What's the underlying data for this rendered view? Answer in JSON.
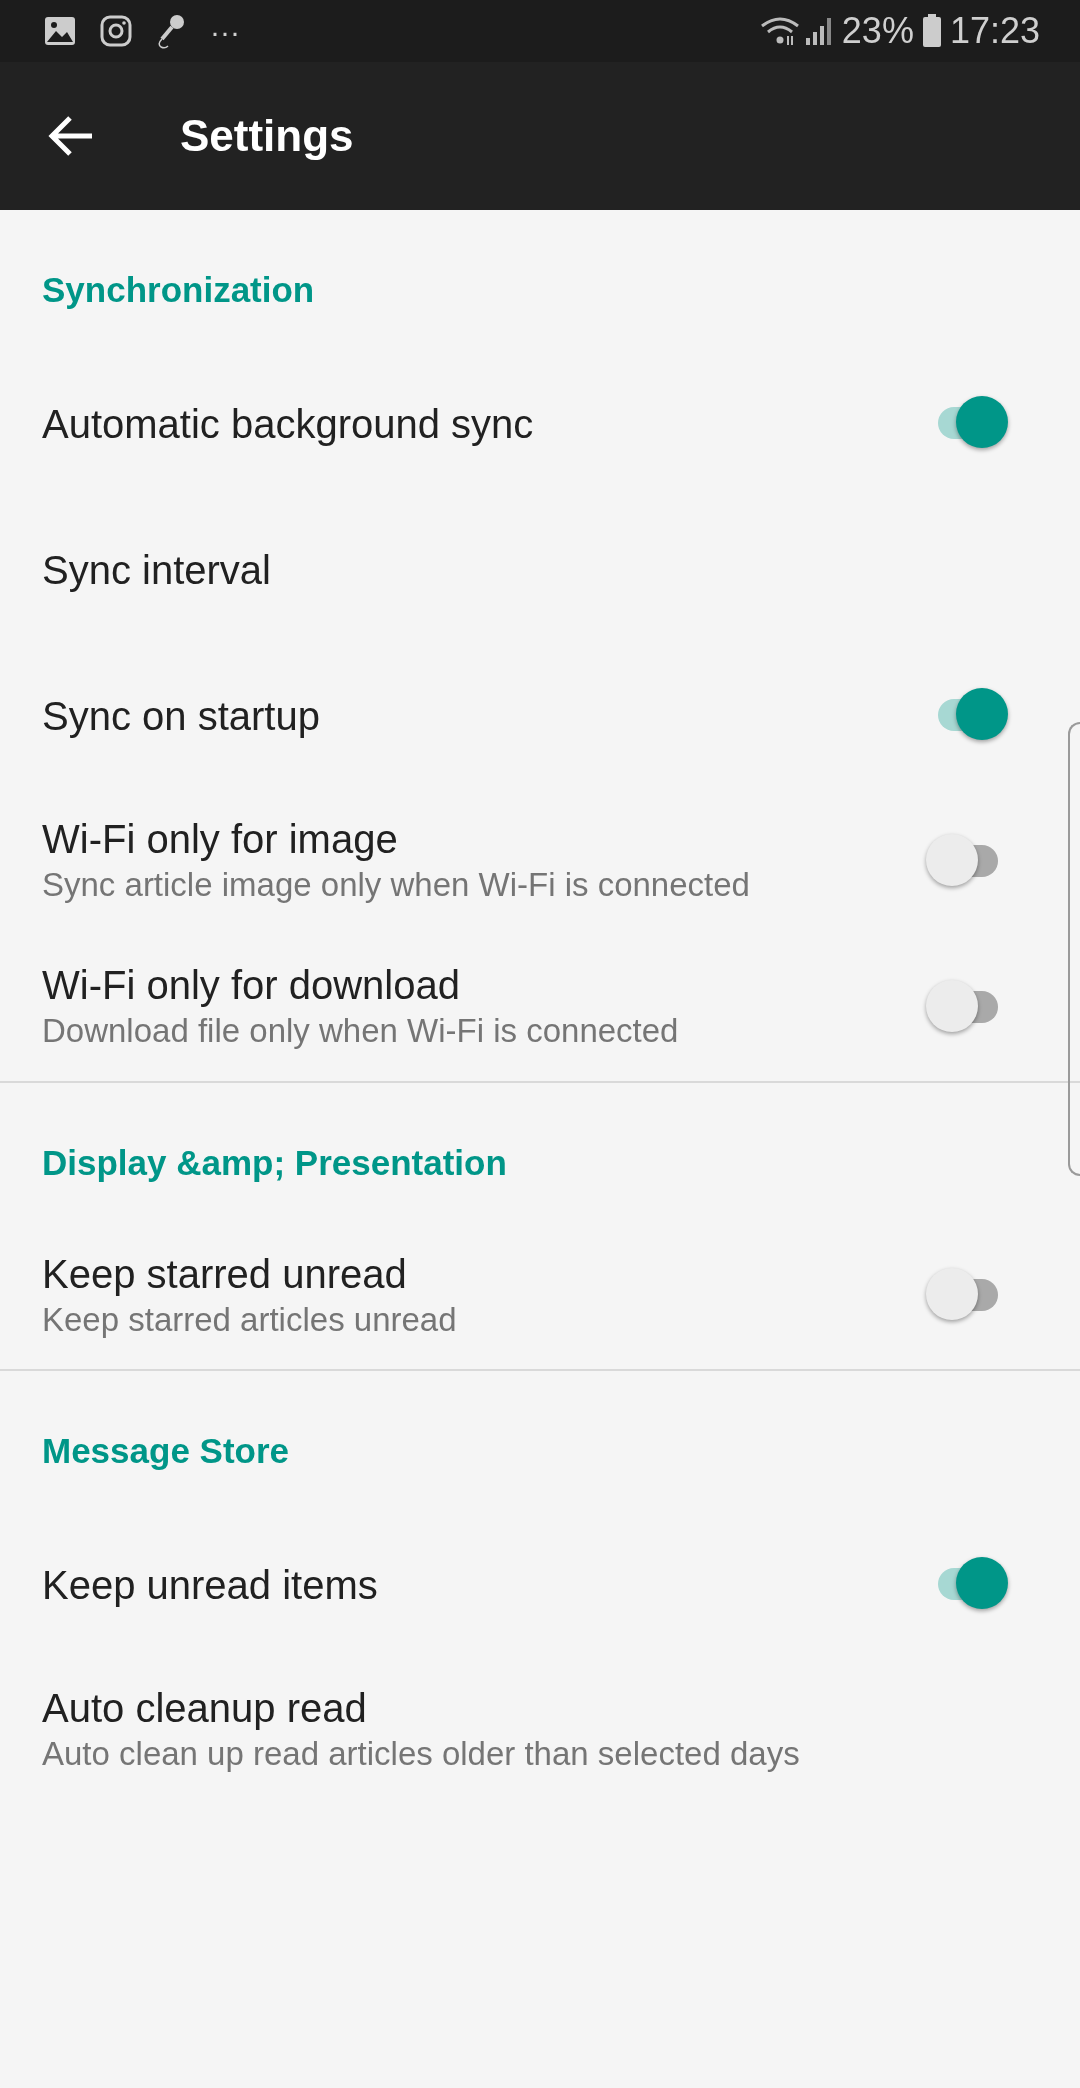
{
  "status_bar": {
    "battery_percent": "23%",
    "time": "17:23",
    "more": "···"
  },
  "toolbar": {
    "title": "Settings"
  },
  "sections": [
    {
      "header": "Synchronization",
      "items": [
        {
          "kind": "switch",
          "title": "Automatic background sync",
          "on": true
        },
        {
          "kind": "plain",
          "title": "Sync interval"
        },
        {
          "kind": "switch",
          "title": "Sync on startup",
          "on": true
        },
        {
          "kind": "switch",
          "title": "Wi-Fi only for image",
          "summary": "Sync article image only when Wi-Fi is connected",
          "on": false
        },
        {
          "kind": "switch",
          "title": "Wi-Fi only for download",
          "summary": "Download file only when Wi-Fi is connected",
          "on": false
        }
      ]
    },
    {
      "header": "Display &amp; Presentation",
      "items": [
        {
          "kind": "switch",
          "title": "Keep starred unread",
          "summary": "Keep starred articles unread",
          "on": false
        }
      ]
    },
    {
      "header": "Message Store",
      "items": [
        {
          "kind": "switch",
          "title": "Keep unread items",
          "on": true
        },
        {
          "kind": "plain",
          "title": "Auto cleanup read",
          "summary": "Auto clean up read articles older than selected days"
        }
      ]
    }
  ]
}
